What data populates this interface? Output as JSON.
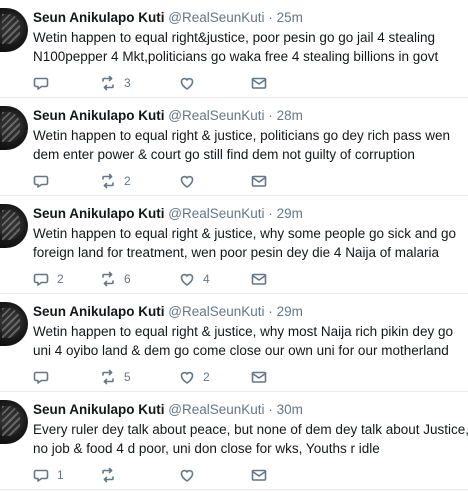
{
  "tweets": [
    {
      "name": "Seun Anikulapo Kuti",
      "handle": "@RealSeunKuti",
      "time": "25m",
      "lines": [
        "Wetin happen to equal right&justice, poor pesin go go jail 4 stealing",
        "N100pepper 4 Mkt,politicians go waka free 4 stealing billions in govt"
      ],
      "replies": "",
      "retweets": "3",
      "likes": ""
    },
    {
      "name": "Seun Anikulapo Kuti",
      "handle": "@RealSeunKuti",
      "time": "28m",
      "lines": [
        "Wetin happen to equal right & justice, politicians go dey rich pass wen",
        "dem enter power & court go still find dem not guilty of corruption"
      ],
      "replies": "",
      "retweets": "2",
      "likes": ""
    },
    {
      "name": "Seun Anikulapo Kuti",
      "handle": "@RealSeunKuti",
      "time": "29m",
      "lines": [
        "Wetin happen to equal right & justice, why some people go sick and go",
        "foreign land for treatment, wen poor pesin dey die 4 Naija of malaria"
      ],
      "replies": "2",
      "retweets": "6",
      "likes": "4"
    },
    {
      "name": "Seun Anikulapo Kuti",
      "handle": "@RealSeunKuti",
      "time": "29m",
      "lines": [
        "Wetin happen to equal right & justice, why most Naija rich pikin dey go",
        "uni 4 oyibo land & dem go come close our own uni for our motherland"
      ],
      "replies": "",
      "retweets": "5",
      "likes": "2"
    },
    {
      "name": "Seun Anikulapo Kuti",
      "handle": "@RealSeunKuti",
      "time": "30m",
      "lines": [
        "Every ruler dey talk about peace, but none of dem dey talk about Justice,",
        "no job & food 4 d poor, uni don close for wks, Youths r idle"
      ],
      "replies": "1",
      "retweets": "",
      "likes": ""
    }
  ],
  "separator": "·",
  "icons": {
    "reply": "reply-icon",
    "retweet": "retweet-icon",
    "like": "heart-icon",
    "message": "envelope-icon"
  }
}
